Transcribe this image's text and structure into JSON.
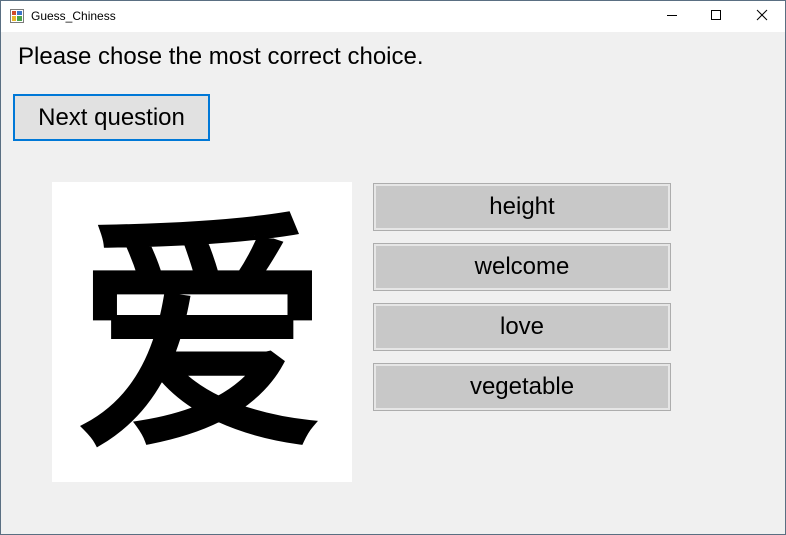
{
  "window": {
    "title": "Guess_Chiness"
  },
  "question": {
    "prompt": "Please chose the most correct choice.",
    "next_label": "Next question",
    "character": "爱"
  },
  "choices": [
    {
      "label": "height"
    },
    {
      "label": "welcome"
    },
    {
      "label": "love"
    },
    {
      "label": "vegetable"
    }
  ],
  "icons": {
    "app": "app-icon",
    "minimize": "minimize-icon",
    "maximize": "maximize-icon",
    "close": "close-icon"
  }
}
